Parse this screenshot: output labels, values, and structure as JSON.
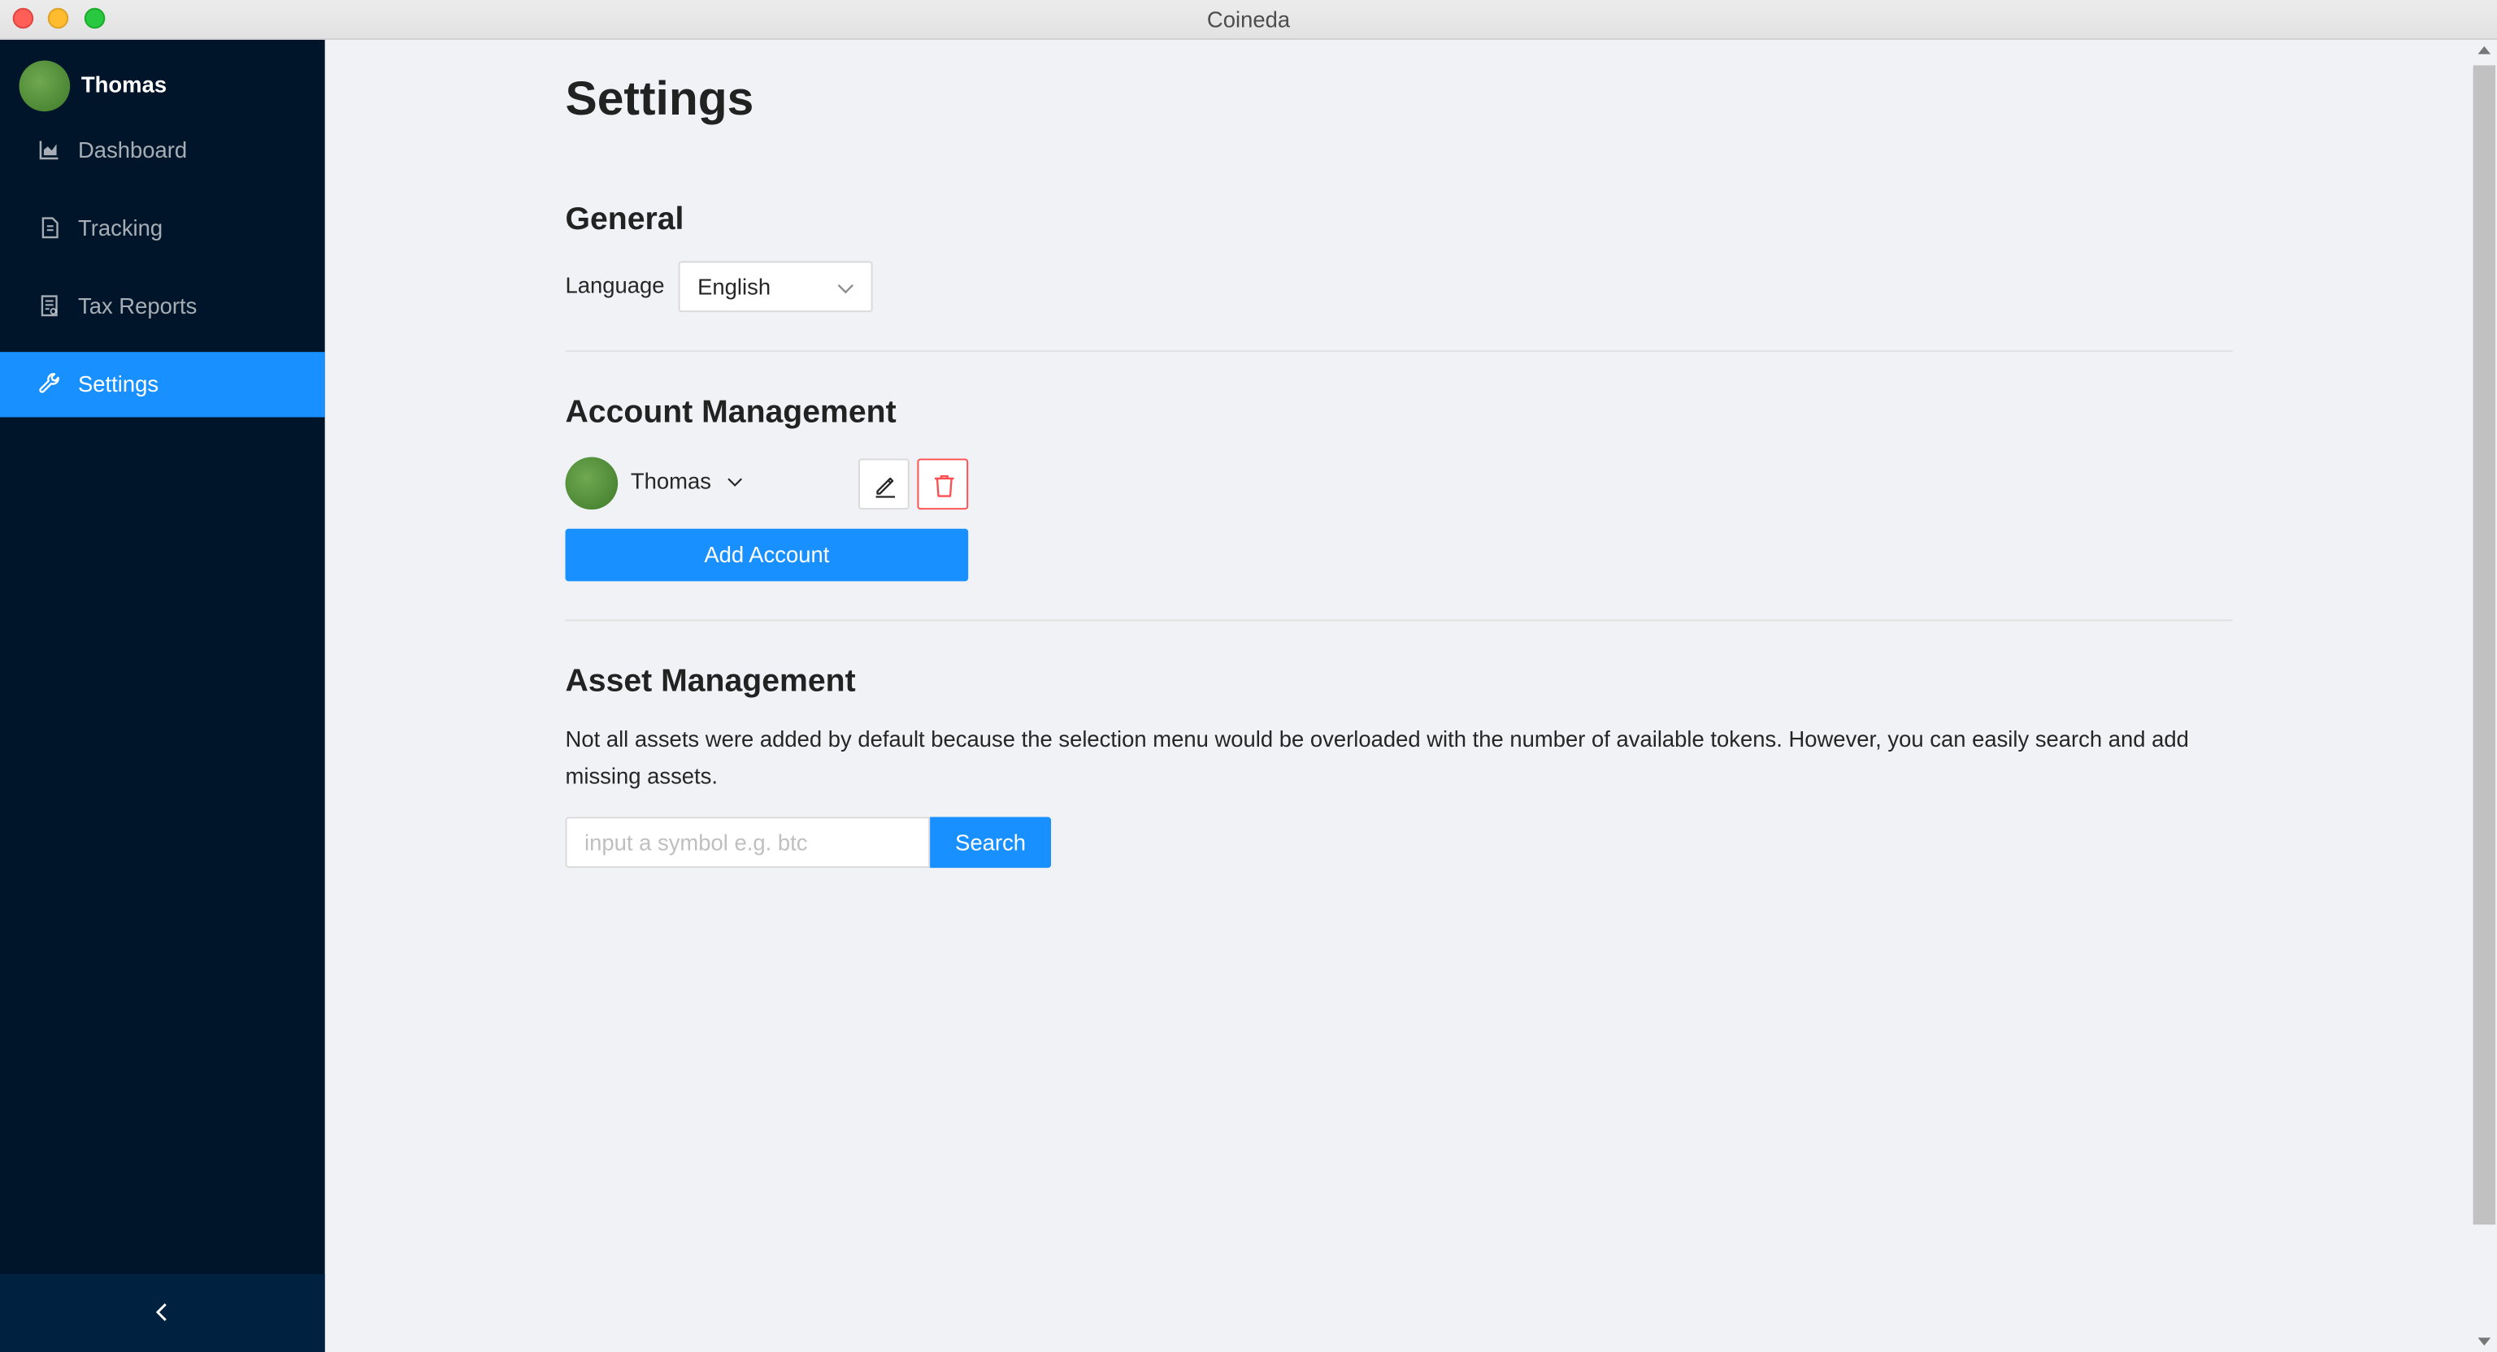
{
  "window": {
    "title": "Coineda"
  },
  "sidebar": {
    "user_name": "Thomas",
    "items": [
      {
        "label": "Dashboard",
        "icon": "chart-icon"
      },
      {
        "label": "Tracking",
        "icon": "file-icon"
      },
      {
        "label": "Tax Reports",
        "icon": "report-icon"
      },
      {
        "label": "Settings",
        "icon": "wrench-icon",
        "active": true
      }
    ],
    "collapse_icon": "chevron-left-icon"
  },
  "main": {
    "title": "Settings",
    "general": {
      "title": "General",
      "language_label": "Language",
      "language_value": "English"
    },
    "account": {
      "title": "Account Management",
      "account_name": "Thomas",
      "add_button": "Add Account"
    },
    "asset": {
      "title": "Asset Management",
      "description": "Not all assets were added by default because the selection menu would be overloaded with the number of available tokens. However, you can easily search and add missing assets.",
      "search_placeholder": "input a symbol e.g. btc",
      "search_button": "Search"
    }
  },
  "colors": {
    "sidebar_bg": "#001529",
    "accent": "#1890ff",
    "danger": "#ff4d4f",
    "content_bg": "#f0f2f5"
  }
}
